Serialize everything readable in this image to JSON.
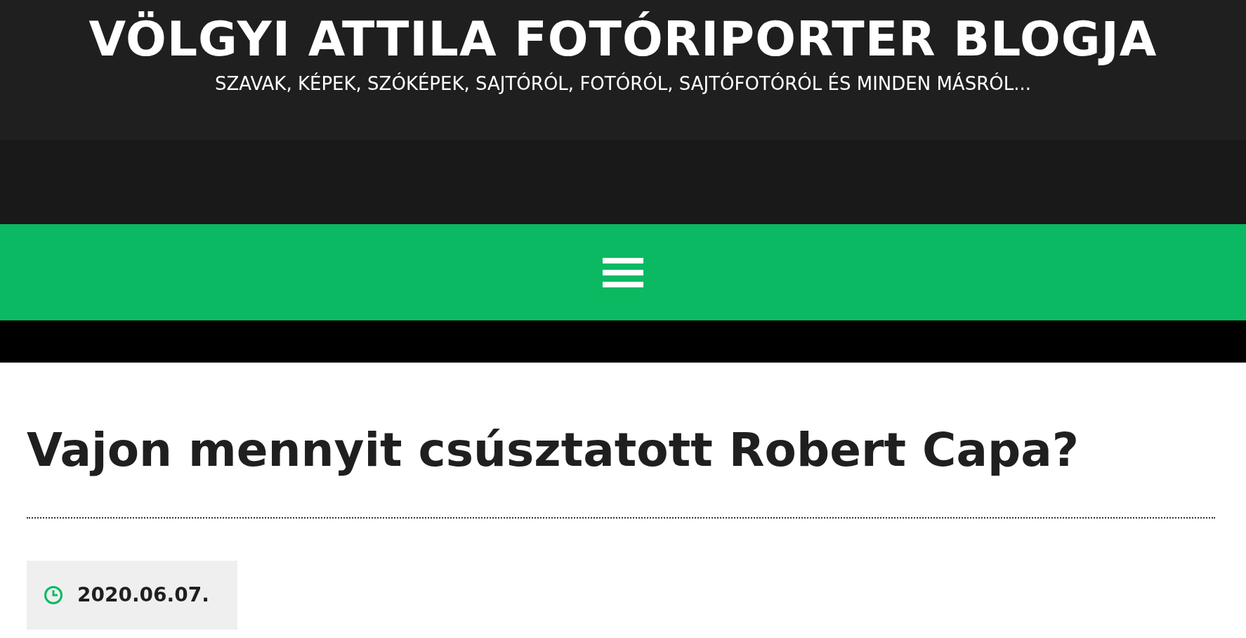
{
  "site": {
    "title": "VÖLGYI ATTILA FOTÓRIPORTER BLOGJA",
    "tagline": "SZAVAK, KÉPEK, SZÓKÉPEK, SAJTÓRÓL, FOTÓRÓL, SAJTÓFOTÓRÓL ÉS MINDEN MÁSRÓL..."
  },
  "post": {
    "title": "Vajon mennyit csúsztatott Robert Capa?",
    "date": "2020.06.07."
  }
}
